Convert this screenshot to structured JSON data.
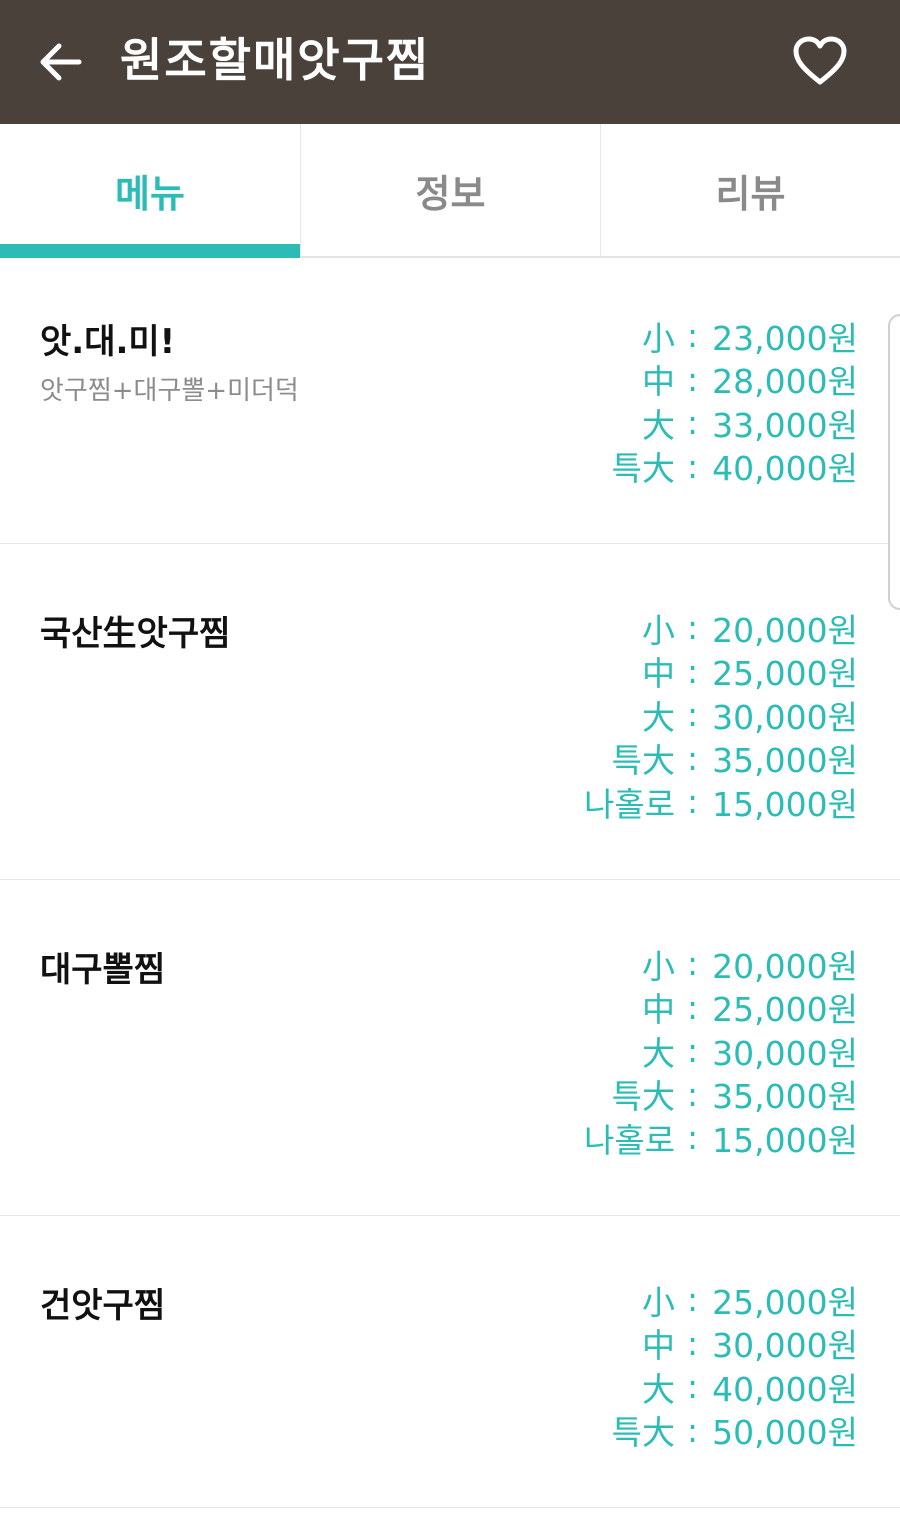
{
  "header": {
    "title": "원조할매앗구찜",
    "back_icon": "arrow-left-icon",
    "favorite_icon": "heart-outline-icon",
    "background_color": "#4a413b"
  },
  "tabs": [
    {
      "label": "메뉴",
      "active": true
    },
    {
      "label": "정보",
      "active": false
    },
    {
      "label": "리뷰",
      "active": false
    }
  ],
  "accent_color": "#2cbcb6",
  "menu": [
    {
      "name": "앗.대.미!",
      "description": "앗구찜+대구뽈+미더덕",
      "prices": [
        {
          "size": "小",
          "price": "23,000원"
        },
        {
          "size": "中",
          "price": "28,000원"
        },
        {
          "size": "大",
          "price": "33,000원"
        },
        {
          "size": "특大",
          "price": "40,000원"
        }
      ]
    },
    {
      "name": "국산生앗구찜",
      "description": "",
      "prices": [
        {
          "size": "小",
          "price": "20,000원"
        },
        {
          "size": "中",
          "price": "25,000원"
        },
        {
          "size": "大",
          "price": "30,000원"
        },
        {
          "size": "특大",
          "price": "35,000원"
        },
        {
          "size": "나홀로",
          "price": "15,000원"
        }
      ]
    },
    {
      "name": "대구뽈찜",
      "description": "",
      "prices": [
        {
          "size": "小",
          "price": "20,000원"
        },
        {
          "size": "中",
          "price": "25,000원"
        },
        {
          "size": "大",
          "price": "30,000원"
        },
        {
          "size": "특大",
          "price": "35,000원"
        },
        {
          "size": "나홀로",
          "price": "15,000원"
        }
      ]
    },
    {
      "name": "건앗구찜",
      "description": "",
      "prices": [
        {
          "size": "小",
          "price": "25,000원"
        },
        {
          "size": "中",
          "price": "30,000원"
        },
        {
          "size": "大",
          "price": "40,000원"
        },
        {
          "size": "특大",
          "price": "50,000원"
        }
      ]
    }
  ]
}
